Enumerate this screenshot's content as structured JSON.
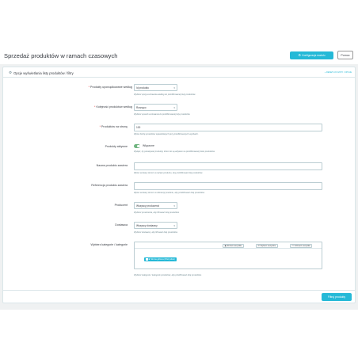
{
  "header": {
    "title": "Sprzedaż produktów w ramach czasowych",
    "config_button": "Konfiguracja modułu",
    "help_button": "Pomoc"
  },
  "card": {
    "title": "Opcje wyświetlania listy produktów / filtry",
    "head_link": "+ RESETUJ FILTRY / OPCJE",
    "filter_button": "Filtruj produkty"
  },
  "fields": {
    "group_by": {
      "label": "Produkty uporządkowane według",
      "required": "*",
      "value": "Id produktu",
      "help": "Wybierz opcję sortowania według do przefiltrowanej listy produktów."
    },
    "order": {
      "label": "Kolejność produktów według",
      "required": "*",
      "value": "Rosnąco",
      "help": "Wybierz sposób sortowania do przefiltrowanej listy produktów."
    },
    "per_page": {
      "label": "Produktów na stronę",
      "required": "*",
      "value": "100",
      "help": "Wpisz liczbę produktów wyświetlanych przy przefiltrowanych wynikach."
    },
    "inactive": {
      "label": "Produkty aktywne",
      "value": "Włączone",
      "help": "Wyłącz, by pokazywać produkty, które nie są aktywne na przefiltrowanej liście produktów."
    },
    "name": {
      "label": "Nazwa produktu zawiera",
      "value": "",
      "help": "Wpisz szukany termin w nazwie produktu, aby przefiltrować listę produktów."
    },
    "reference": {
      "label": "Referencja produktu zawiera",
      "value": "",
      "help": "Wpisz szukany termin w referencji produktu, aby przefiltrować listę produktów."
    },
    "manufacturer": {
      "label": "Producent",
      "value": "Wszyscy producenci",
      "help": "Wybierz producenta, aby filtrować listę produktów."
    },
    "supplier": {
      "label": "Dostawca",
      "value": "Wszyscy dostawcy",
      "help": "Wybierz dostawcę, aby filtrować listę produktów."
    },
    "categories": {
      "label": "Wybierz kategorie / kategorie",
      "collapse": "Rozwiń wszystkie",
      "select_all": "Wybierz wszystkie",
      "unselect_all": "Odznacz wszystkie",
      "root": "Strona główna (Wszystkie)",
      "help": "Wybierz kategorie / kategorie produktów, aby przefiltrować listę produktów."
    }
  },
  "colors": {
    "accent": "#25b9d7",
    "toggle_on": "#70b580",
    "required": "#e63838"
  }
}
